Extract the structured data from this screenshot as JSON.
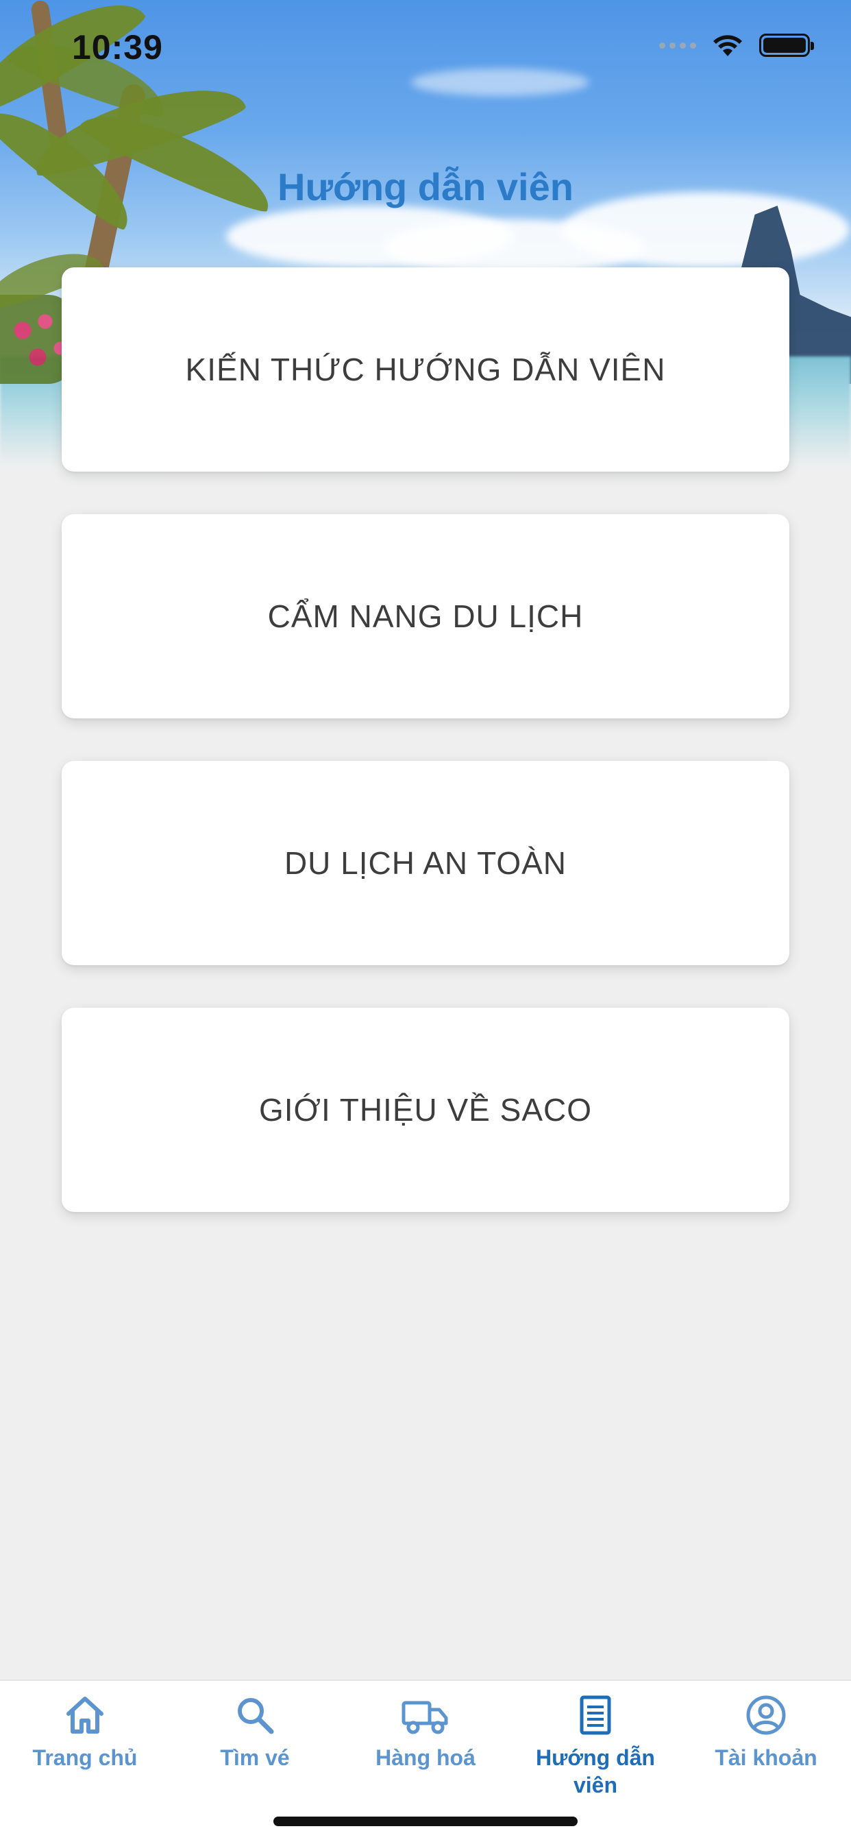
{
  "status_bar": {
    "time": "10:39"
  },
  "header": {
    "title": "Hướng dẫn viên"
  },
  "menu": {
    "items": [
      {
        "label": "KIẾN THỨC HƯỚNG DẪN VIÊN"
      },
      {
        "label": "CẨM NANG DU LỊCH"
      },
      {
        "label": "DU LỊCH AN TOÀN"
      },
      {
        "label": "GIỚI THIỆU VỀ SACO"
      }
    ]
  },
  "tabbar": {
    "active_index": 3,
    "items": [
      {
        "label": "Trang chủ",
        "icon": "home-icon"
      },
      {
        "label": "Tìm vé",
        "icon": "search-icon"
      },
      {
        "label": "Hàng hoá",
        "icon": "truck-icon"
      },
      {
        "label": "Hướng dẫn viên",
        "icon": "document-icon"
      },
      {
        "label": "Tài khoản",
        "icon": "account-icon"
      }
    ]
  },
  "colors": {
    "title": "#2b7bc8",
    "tab_inactive": "#5b94cf",
    "tab_active": "#1f6db7",
    "background": "#efefef"
  }
}
